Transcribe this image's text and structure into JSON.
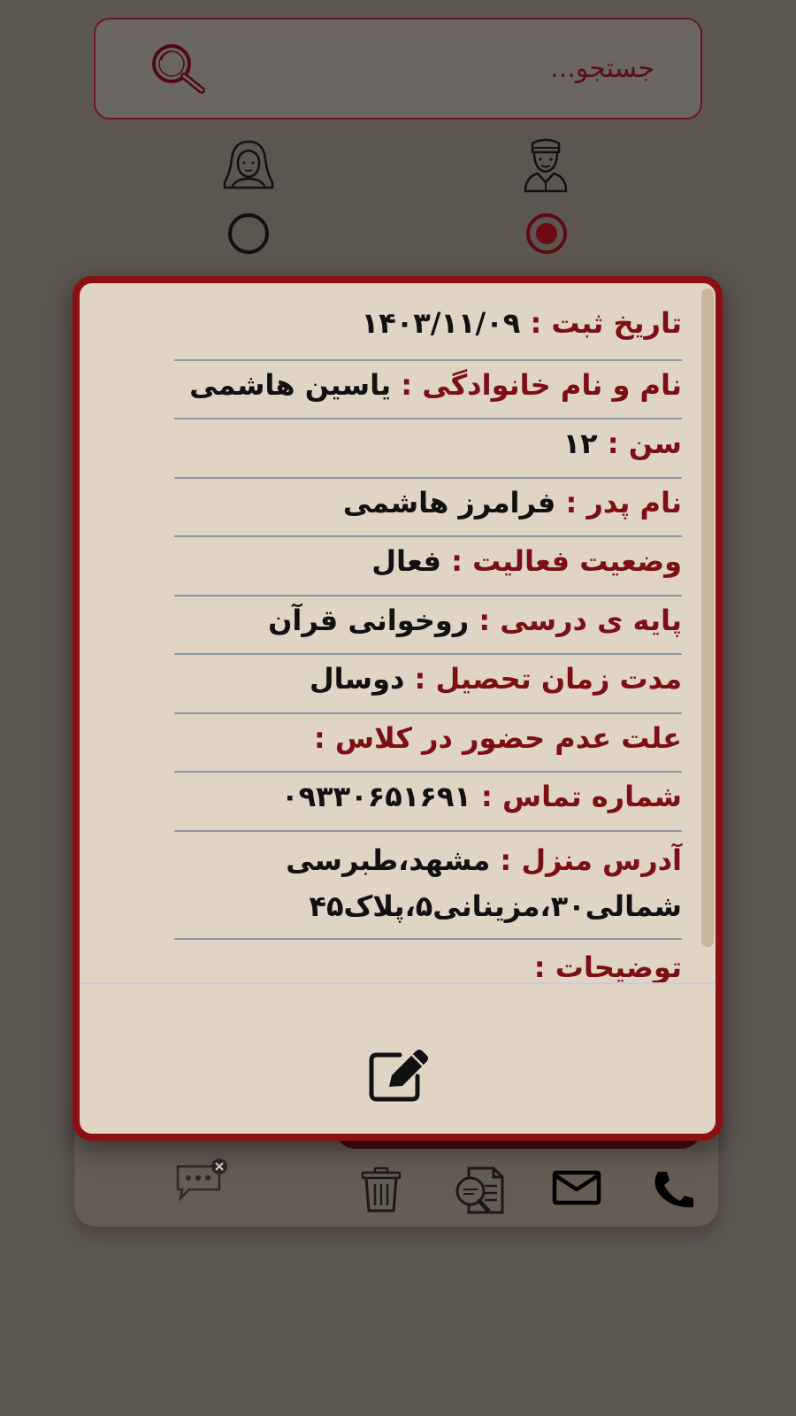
{
  "search": {
    "placeholder": "جستجو..."
  },
  "gender": {
    "options": [
      {
        "name": "male-icon",
        "selected": true
      },
      {
        "name": "female-icon",
        "selected": false
      }
    ]
  },
  "details": {
    "rows": [
      {
        "label": "تاریخ ثبت :",
        "value": "۱۴۰۳/۱۱/۰۹"
      },
      {
        "label": "نام و نام خانوادگی :",
        "value": "یاسین هاشمی"
      },
      {
        "label": "سن :",
        "value": "۱۲"
      },
      {
        "label": "نام پدر :",
        "value": "فرامرز هاشمی"
      },
      {
        "label": "وضعیت فعالیت :",
        "value": "فعال"
      },
      {
        "label": "پایه ی درسی :",
        "value": "روخوانی قرآن"
      },
      {
        "label": "مدت زمان تحصیل :",
        "value": "دوسال"
      },
      {
        "label": "علت عدم حضور در کلاس :",
        "value": ""
      },
      {
        "label": "شماره تماس :",
        "value": "۰۹۳۳۰۶۵۱۶۹۱"
      },
      {
        "label": "آدرس منزل :",
        "value": "مشهد،طبرسی شمالی۳۰،مزینانی۵،پلاک۴۵"
      },
      {
        "label": "توضیحات :",
        "value": ""
      }
    ]
  },
  "actions": [
    "phone-icon",
    "mail-icon",
    "document-search-icon",
    "trash-icon",
    "message-icon"
  ],
  "colors": {
    "accent": "#8c0f14",
    "label": "#7c0f14",
    "background": "#5c5650",
    "card": "#e0d4c5"
  }
}
